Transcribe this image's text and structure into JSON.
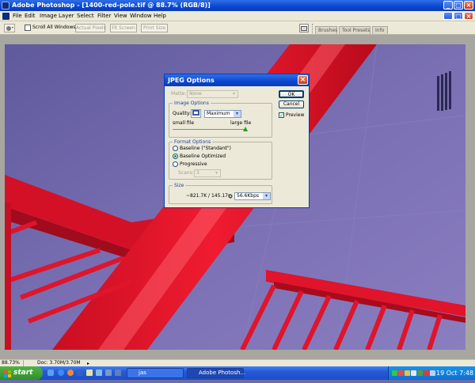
{
  "app": {
    "title": "Adobe Photoshop - [1400-red-pole.tif @ 88.7% (RGB/8)]"
  },
  "window_controls": {
    "minimize": "_",
    "maximize": "□",
    "close": "×"
  },
  "menu": [
    "File",
    "Edit",
    "Image",
    "Layer",
    "Select",
    "Filter",
    "View",
    "Window",
    "Help"
  ],
  "options_bar": {
    "scroll_all_windows": "Scroll All Windows",
    "actual_pixels": "Actual Pixels",
    "fit_screen": "Fit Screen",
    "print_size": "Print Size",
    "palette_tabs": [
      "Brushes",
      "Tool Presets",
      "Info"
    ]
  },
  "dialog": {
    "title": "JPEG Options",
    "close_glyph": "×",
    "matte_label": "Matte:",
    "matte_value": "None",
    "image_options": {
      "label": "Image Options",
      "quality_label": "Quality:",
      "quality_number": "10",
      "quality_preset": "Maximum",
      "small_file": "small file",
      "large_file": "large file"
    },
    "format_options": {
      "label": "Format Options",
      "options": [
        "Baseline (\"Standard\")",
        "Baseline Optimized",
        "Progressive"
      ],
      "selected": "Baseline Optimized",
      "scans_label": "Scans:",
      "scans_value": "3"
    },
    "size": {
      "label": "Size",
      "text": "~821.7K / 145.17s",
      "speed": "56.6Kbps"
    },
    "ok": "OK",
    "cancel": "Cancel",
    "preview": "Preview",
    "preview_checked": true
  },
  "status": {
    "zoom": "88.73%",
    "doc": "Doc: 3.70M/3.70M"
  },
  "taskbar": {
    "start": "start",
    "items": [
      "jas",
      "Adobe Photosh..."
    ],
    "clock": "19 Oct 7:48"
  },
  "colors": {
    "xp_blue": "#0a46d0",
    "canvas_purple": "#6a64a5",
    "pole_red": "#e8142a"
  }
}
